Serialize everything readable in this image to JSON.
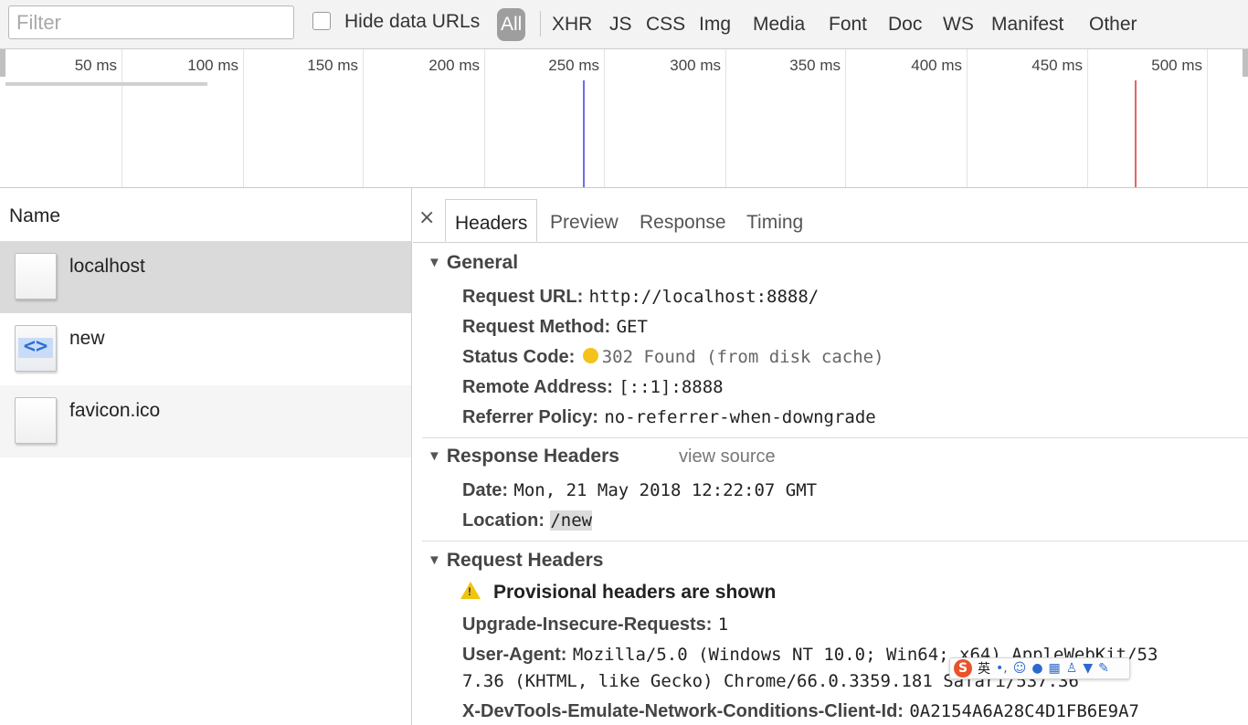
{
  "filterbar": {
    "filter_placeholder": "Filter",
    "hide_data_urls_label": "Hide data URLs",
    "types": [
      "All",
      "XHR",
      "JS",
      "CSS",
      "Img",
      "Media",
      "Font",
      "Doc",
      "WS",
      "Manifest",
      "Other"
    ],
    "active_type": "All"
  },
  "timeline": {
    "ticks": [
      "50 ms",
      "100 ms",
      "150 ms",
      "200 ms",
      "250 ms",
      "300 ms",
      "350 ms",
      "400 ms",
      "450 ms",
      "500 ms"
    ],
    "dom_content_loaded_color": "#6f6fe6",
    "load_color": "#e86363"
  },
  "requests": {
    "column_name": "Name",
    "rows": [
      {
        "name": "localhost",
        "icon": "blank-file-icon"
      },
      {
        "name": "new",
        "icon": "html-document-icon"
      },
      {
        "name": "favicon.ico",
        "icon": "blank-file-icon"
      }
    ]
  },
  "details": {
    "close_glyph": "×",
    "tabs": [
      "Headers",
      "Preview",
      "Response",
      "Timing"
    ],
    "active_tab": "Headers",
    "general": {
      "title": "General",
      "request_url_key": "Request URL:",
      "request_url": "http://localhost:8888/",
      "request_method_key": "Request Method:",
      "request_method": "GET",
      "status_code_key": "Status Code:",
      "status_code": "302 Found (from disk cache)",
      "status_color": "#f4c21b",
      "remote_address_key": "Remote Address:",
      "remote_address": "[::1]:8888",
      "referrer_policy_key": "Referrer Policy:",
      "referrer_policy": "no-referrer-when-downgrade"
    },
    "response_headers": {
      "title": "Response Headers",
      "view_source": "view source",
      "date_key": "Date:",
      "date": "Mon, 21 May 2018 12:22:07 GMT",
      "location_key": "Location:",
      "location": "/new"
    },
    "request_headers": {
      "title": "Request Headers",
      "provisional": "Provisional headers are shown",
      "upgrade_key": "Upgrade-Insecure-Requests:",
      "upgrade": "1",
      "user_agent_key": "User-Agent:",
      "user_agent_line1": "Mozilla/5.0 (Windows NT 10.0; Win64; x64) AppleWebKit/53",
      "user_agent_line2": "7.36 (KHTML, like Gecko) Chrome/66.0.3359.181 Safari/537.36",
      "client_id_key": "X-DevTools-Emulate-Network-Conditions-Client-Id:",
      "client_id": "0A2154A6A28C4D1FB6E9A7"
    }
  },
  "ime": {
    "logo": "S",
    "mode": "英"
  }
}
